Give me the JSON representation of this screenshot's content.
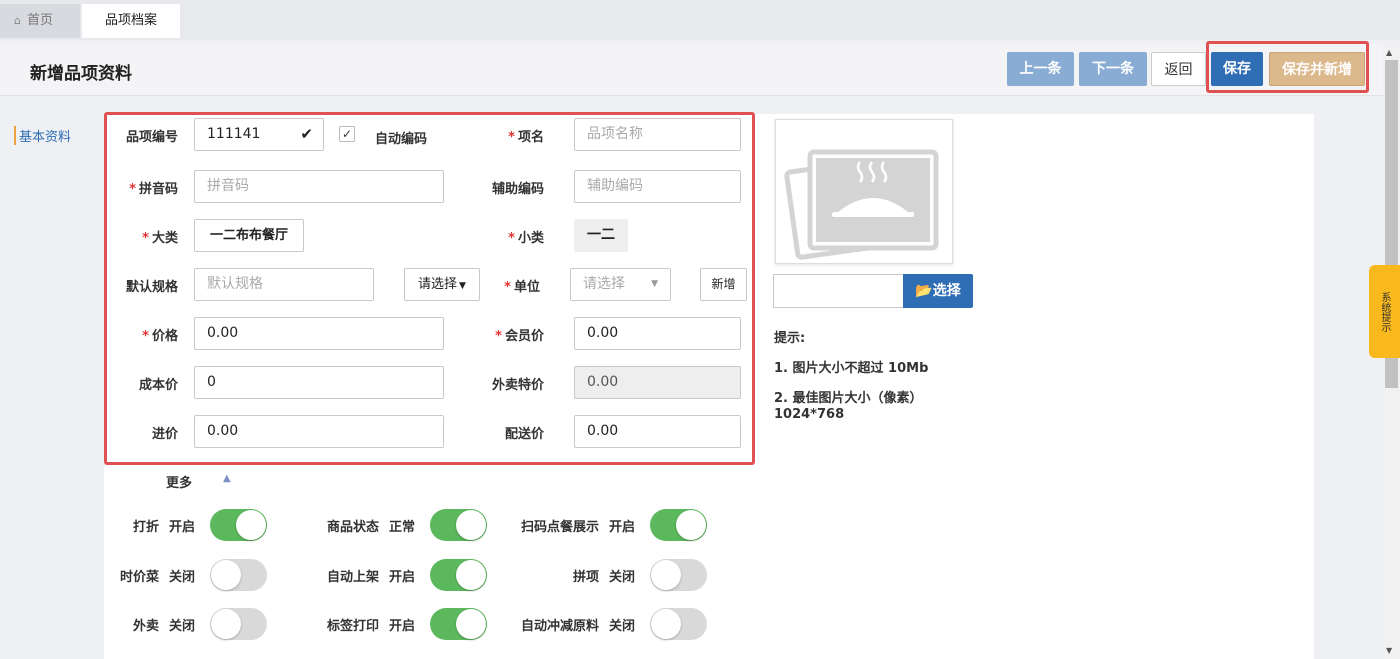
{
  "tabs": {
    "home": "首页",
    "active": "品项档案"
  },
  "header": {
    "title": "新增品项资料",
    "prev": "上一条",
    "next": "下一条",
    "back": "返回",
    "save": "保存",
    "save_new": "保存并新增"
  },
  "left_tab": "基本资料",
  "form": {
    "code_label": "品项编号",
    "code_value": "111141",
    "auto_code_label": "自动编码",
    "name_label": "项名",
    "name_placeholder": "品项名称",
    "pinyin_label": "拼音码",
    "pinyin_placeholder": "拼音码",
    "aux_label": "辅助编码",
    "aux_placeholder": "辅助编码",
    "category_label": "大类",
    "category_value": "一二布布餐厅",
    "subcategory_label": "小类",
    "subcategory_value": "一二",
    "spec_label": "默认规格",
    "spec_placeholder": "默认规格",
    "spec_select": "请选择",
    "unit_label": "单位",
    "unit_placeholder": "请选择",
    "unit_add": "新增",
    "price_label": "价格",
    "price_value": "0.00",
    "member_label": "会员价",
    "member_value": "0.00",
    "cost_label": "成本价",
    "cost_value": "0",
    "takeout_label": "外卖特价",
    "takeout_value": "0.00",
    "purchase_label": "进价",
    "purchase_value": "0.00",
    "delivery_label": "配送价",
    "delivery_value": "0.00"
  },
  "image": {
    "choose": "选择",
    "tips_title": "提示:",
    "tip1": "1. 图片大小不超过 10Mb",
    "tip2": "2. 最佳图片大小（像素）",
    "tip2_size": "1024*768"
  },
  "more": "更多",
  "toggles": [
    {
      "label": "打折",
      "state": "开启",
      "on": true
    },
    {
      "label": "商品状态",
      "state": "正常",
      "on": true
    },
    {
      "label": "扫码点餐展示",
      "state": "开启",
      "on": true
    },
    {
      "label": "时价菜",
      "state": "关闭",
      "on": false
    },
    {
      "label": "自动上架",
      "state": "开启",
      "on": true
    },
    {
      "label": "拼项",
      "state": "关闭",
      "on": false
    },
    {
      "label": "外卖",
      "state": "关闭",
      "on": false
    },
    {
      "label": "标签打印",
      "state": "开启",
      "on": true
    },
    {
      "label": "自动冲减原料",
      "state": "关闭",
      "on": false
    }
  ],
  "system_tip": "系统提示",
  "colors": {
    "primary": "#2f6db4",
    "toggle_on": "#5cb85c",
    "highlight": "#e05252",
    "warning_tab": "#f9b81b"
  }
}
